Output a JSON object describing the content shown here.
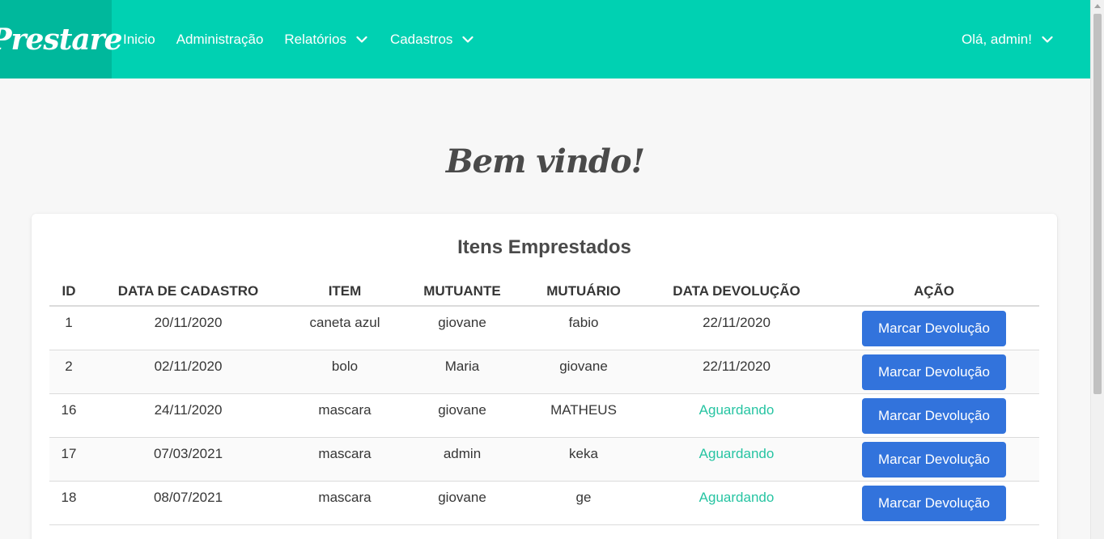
{
  "navbar": {
    "brand": "Prestare",
    "items": [
      {
        "label": "Inicio"
      },
      {
        "label": "Administração"
      },
      {
        "label": "Relatórios"
      },
      {
        "label": "Cadastros"
      }
    ],
    "user_greeting": "Olá, admin!"
  },
  "welcome": "Bem vindo!",
  "card": {
    "title": "Itens Emprestados",
    "columns": [
      "ID",
      "DATA DE CADASTRO",
      "ITEM",
      "MUTUANTE",
      "MUTUÁRIO",
      "DATA DEVOLUÇÃO",
      "AÇÃO"
    ],
    "rows": [
      {
        "id": "1",
        "data": "20/11/2020",
        "item": "caneta azul",
        "mutuante": "giovane",
        "mutuario": "fabio",
        "devolucao": "22/11/2020",
        "acao": "Marcar Devolução"
      },
      {
        "id": "2",
        "data": "02/11/2020",
        "item": "bolo",
        "mutuante": "Maria",
        "mutuario": "giovane",
        "devolucao": "22/11/2020",
        "acao": "Marcar Devolução"
      },
      {
        "id": "16",
        "data": "24/11/2020",
        "item": "mascara",
        "mutuante": "giovane",
        "mutuario": "MATHEUS",
        "devolucao": "Aguardando",
        "acao": "Marcar Devolução"
      },
      {
        "id": "17",
        "data": "07/03/2021",
        "item": "mascara",
        "mutuante": "admin",
        "mutuario": "keka",
        "devolucao": "Aguardando",
        "acao": "Marcar Devolução"
      },
      {
        "id": "18",
        "data": "08/07/2021",
        "item": "mascara",
        "mutuante": "giovane",
        "mutuario": "ge",
        "devolucao": "Aguardando",
        "acao": "Marcar Devolução"
      }
    ]
  },
  "colors": {
    "primary": "#00d1b2",
    "brand_bg": "#00b89c",
    "button": "#3273dc",
    "pending_text": "#26c4a2"
  },
  "icons": {
    "dropdown": "chevron-down-icon"
  }
}
